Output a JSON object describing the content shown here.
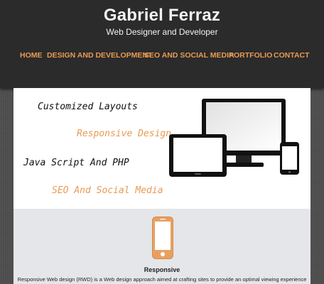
{
  "header": {
    "title": "Gabriel Ferraz",
    "subtitle": "Web Designer and Developer"
  },
  "nav": {
    "items": [
      {
        "label": "HOME"
      },
      {
        "label": "DESIGN AND DEVELOPMENT"
      },
      {
        "label": "SEO AND SOCIAL MEDIA"
      },
      {
        "label": "PORTFOLIO"
      },
      {
        "label": "CONTACT"
      }
    ]
  },
  "hero": {
    "taglines": [
      {
        "text": "Customized Layouts"
      },
      {
        "text": "Responsive Design"
      },
      {
        "text": "Java Script And PHP"
      },
      {
        "text": "SEO And Social Media"
      }
    ]
  },
  "info": {
    "icon": "smartphone-icon",
    "title": "Responsive",
    "text": "Responsive Web design (RWD) is a Web design approach aimed at crafting sites to provide an optimal viewing experience"
  },
  "colors": {
    "accent": "#e89a53",
    "header_bg": "#2b2b2b",
    "info_bg": "#e4e6e9"
  }
}
